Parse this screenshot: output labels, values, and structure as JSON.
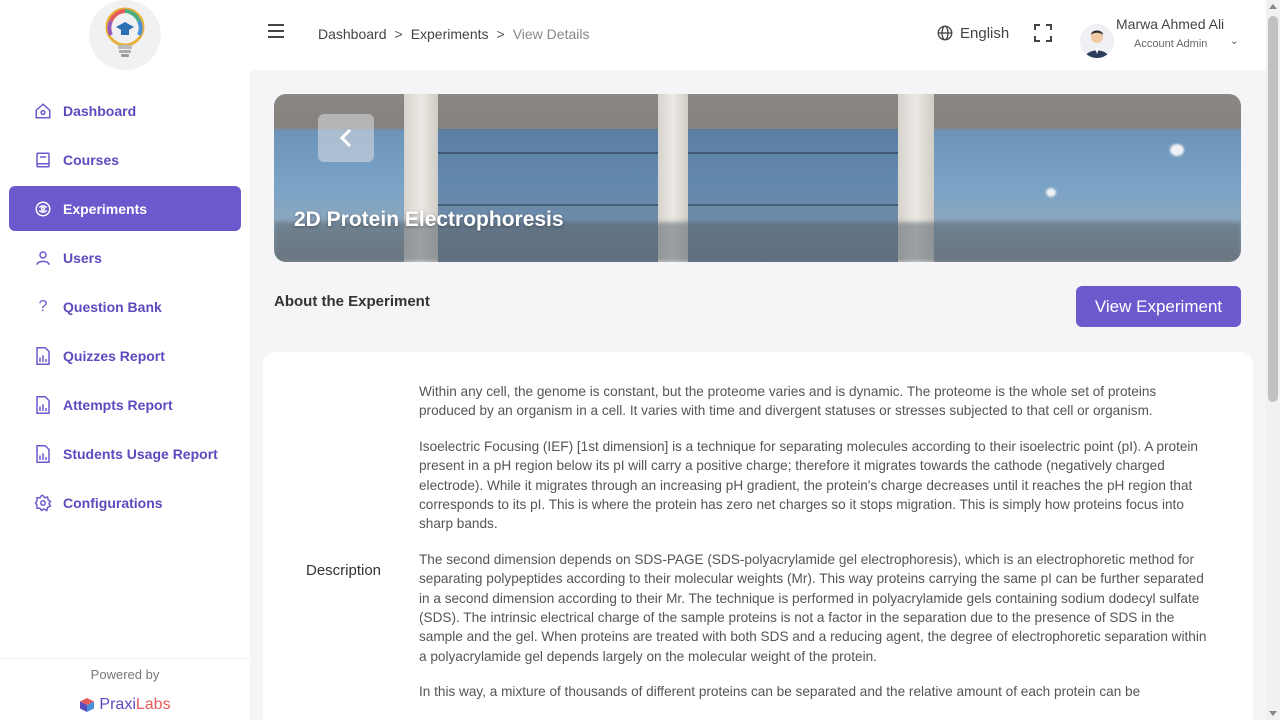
{
  "sidebar": {
    "items": [
      {
        "label": "Dashboard",
        "icon": "home-icon",
        "active": false
      },
      {
        "label": "Courses",
        "icon": "book-icon",
        "active": false
      },
      {
        "label": "Experiments",
        "icon": "flask-icon",
        "active": true
      },
      {
        "label": "Users",
        "icon": "user-icon",
        "active": false
      },
      {
        "label": "Question Bank",
        "icon": "question-icon",
        "active": false
      },
      {
        "label": "Quizzes Report",
        "icon": "report-icon",
        "active": false
      },
      {
        "label": "Attempts Report",
        "icon": "report-icon",
        "active": false
      },
      {
        "label": "Students Usage Report",
        "icon": "report-icon",
        "active": false
      },
      {
        "label": "Configurations",
        "icon": "gear-icon",
        "active": false
      }
    ],
    "powered_by": "Powered by",
    "brand_prefix": "Praxi",
    "brand_suffix": "Labs"
  },
  "header": {
    "breadcrumb": [
      "Dashboard",
      "Experiments",
      "View Details"
    ],
    "breadcrumb_sep": ">",
    "language": "English",
    "user_name": "Marwa Ahmed Ali",
    "user_role": "Account Admin"
  },
  "banner": {
    "title": "2D Protein Electrophoresis"
  },
  "main": {
    "about_heading": "About the Experiment",
    "view_button": "View Experiment",
    "description_label": "Description",
    "paragraphs": [
      "Within any cell, the genome is constant, but the proteome varies and is dynamic. The proteome is the whole set of proteins produced by an organism in a cell. It varies with time and divergent statuses or stresses subjected to that cell or organism.",
      "Isoelectric Focusing (IEF) [1st dimension] is a technique for separating molecules according to their isoelectric point (pI). A protein present in a pH region below its pI will carry a positive charge; therefore it migrates towards the cathode (negatively charged electrode). While it migrates through an increasing pH gradient, the protein's charge decreases until it reaches the pH region that corresponds to its pI. This is where the protein has zero net charges so it stops migration. This is simply how proteins focus into sharp bands.",
      "The second dimension depends on SDS-PAGE (SDS-polyacrylamide gel electrophoresis), which is an electrophoretic method for separating polypeptides according to their molecular weights (Mr). This way proteins carrying the same pI can be further separated in a second dimension according to their Mr. The technique is performed in polyacrylamide gels containing sodium dodecyl sulfate (SDS). The intrinsic electrical charge of the sample proteins is not a factor in the separation due to the presence of SDS in the sample and the gel. When proteins are treated with both SDS and a reducing agent, the degree of electrophoretic separation within a polyacrylamide gel depends largely on the molecular weight of the protein.",
      "In this way, a mixture of thousands of different proteins can be separated and the relative amount of each protein can be"
    ]
  },
  "colors": {
    "accent": "#6a5acd",
    "nav_text": "#5b4bbf"
  }
}
